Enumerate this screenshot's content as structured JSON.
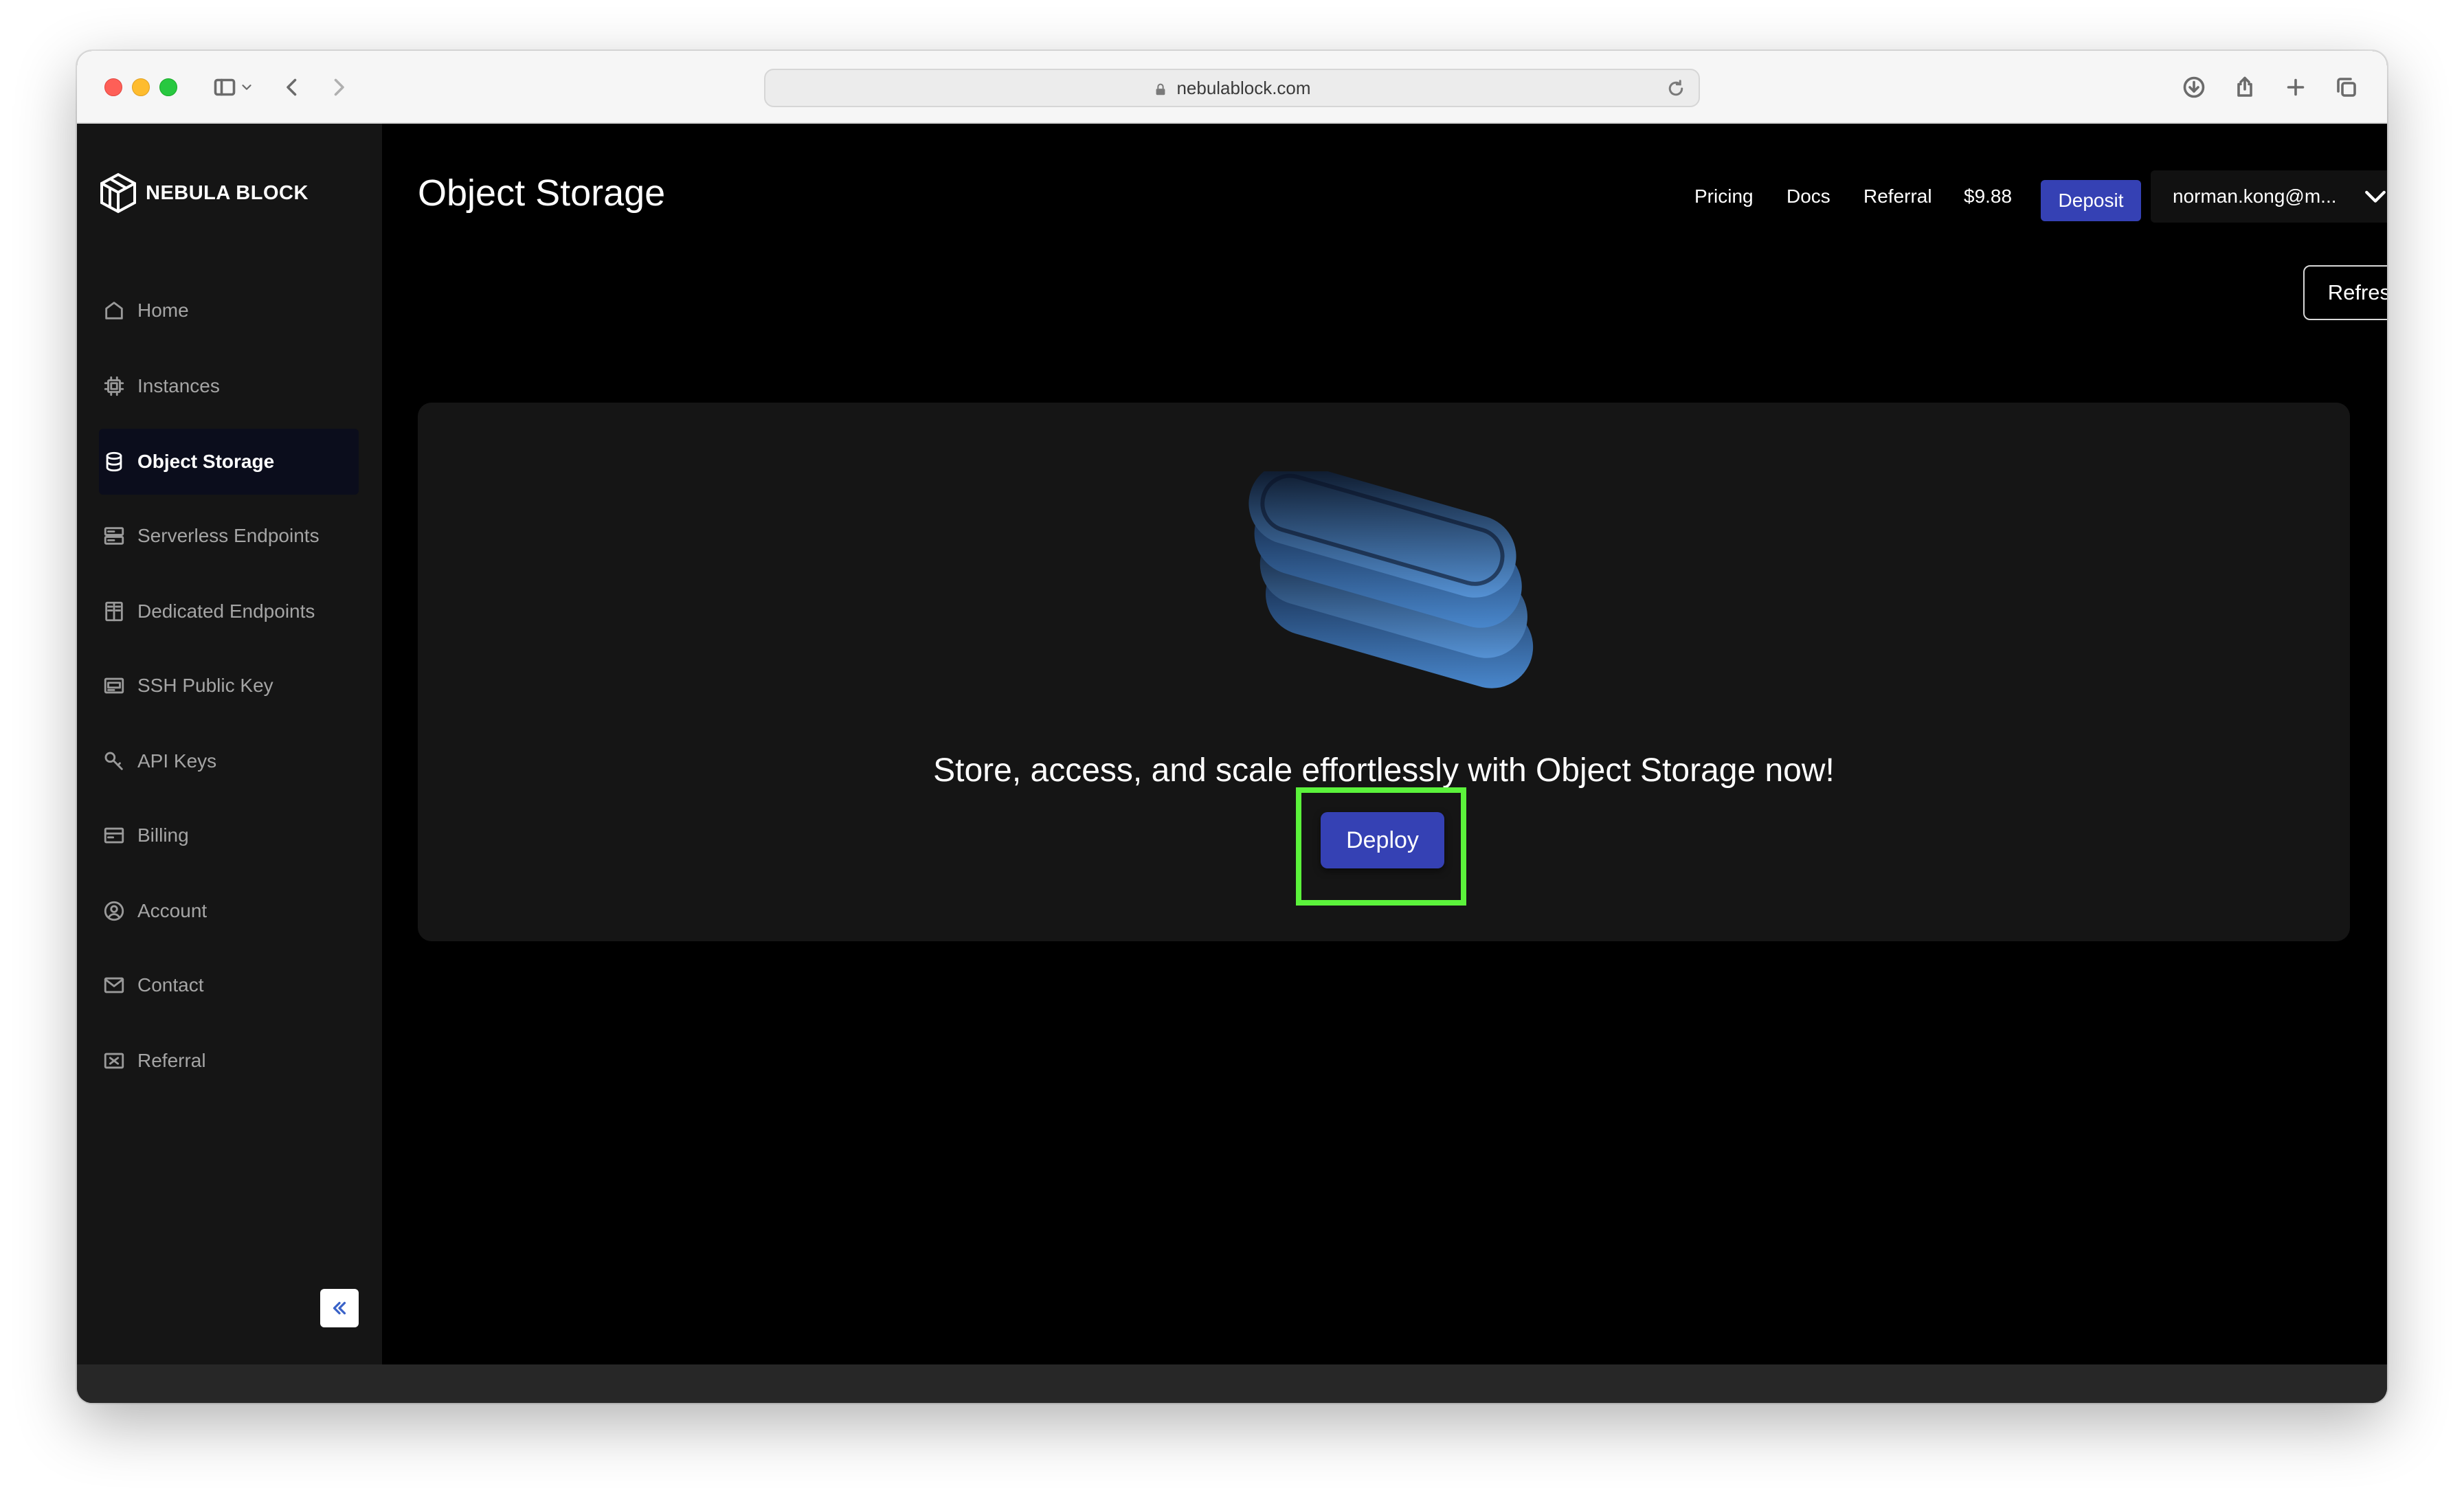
{
  "browser": {
    "url": "nebulablock.com"
  },
  "sidebar": {
    "brand": "NEBULA BLOCK",
    "items": [
      {
        "label": "Home",
        "icon": "home-icon"
      },
      {
        "label": "Instances",
        "icon": "chip-icon"
      },
      {
        "label": "Object Storage",
        "icon": "database-icon",
        "active": true
      },
      {
        "label": "Serverless Endpoints",
        "icon": "server-icon"
      },
      {
        "label": "Dedicated Endpoints",
        "icon": "columns-icon"
      },
      {
        "label": "SSH Public Key",
        "icon": "key-card-icon"
      },
      {
        "label": "API Keys",
        "icon": "key-icon"
      },
      {
        "label": "Billing",
        "icon": "billing-icon"
      },
      {
        "label": "Account",
        "icon": "user-circle-icon"
      },
      {
        "label": "Contact",
        "icon": "mail-icon"
      },
      {
        "label": "Referral",
        "icon": "ticket-icon"
      }
    ]
  },
  "header": {
    "title": "Object Storage",
    "links": {
      "pricing": "Pricing",
      "docs": "Docs",
      "referral": "Referral"
    },
    "balance": "$9.88",
    "deposit_label": "Deposit",
    "user": "norman.kong@m..."
  },
  "main": {
    "refresh_label": "Refresh",
    "cta_text": "Store, access, and scale effortlessly with Object Storage now!",
    "deploy_label": "Deploy"
  },
  "colors": {
    "accent": "#3541b4",
    "highlight": "#5bf23b",
    "sidebar_bg": "#151515",
    "card_bg": "#151515"
  }
}
